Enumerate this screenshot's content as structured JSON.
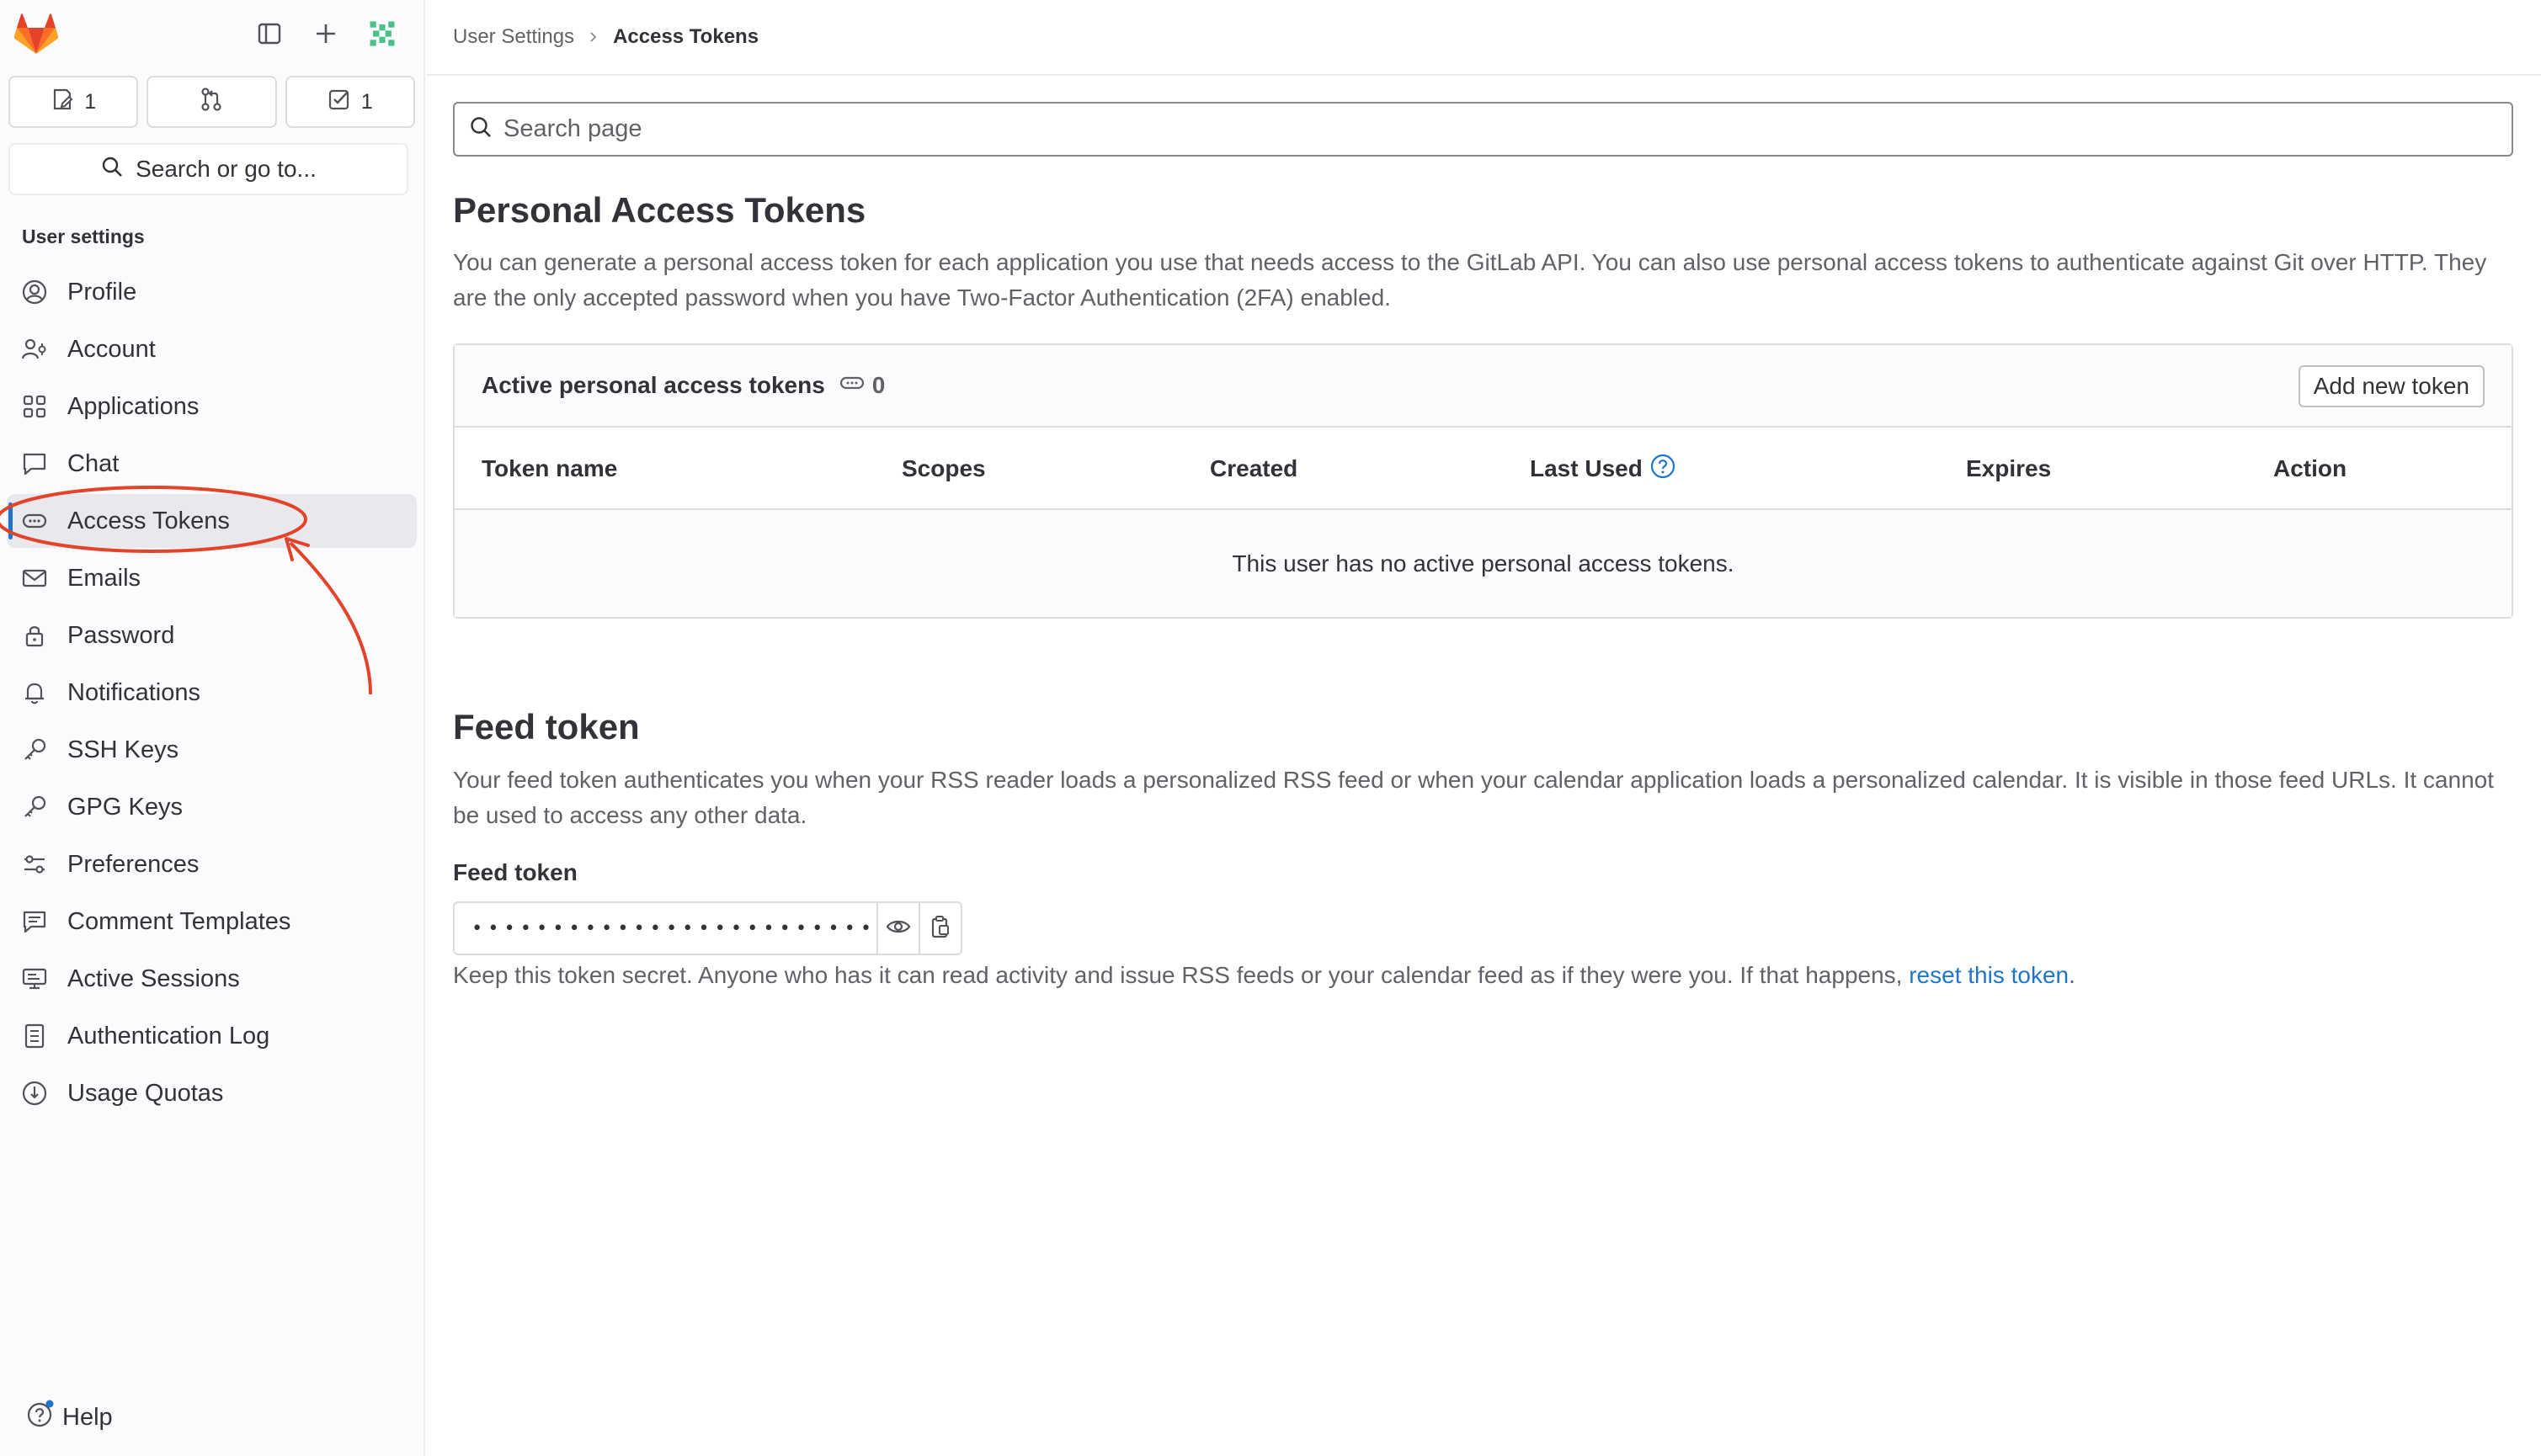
{
  "sidebar": {
    "counts": {
      "issues": "1",
      "todos": "1"
    },
    "search_label": "Search or go to...",
    "section_title": "User settings",
    "items": [
      {
        "label": "Profile",
        "icon": "profile-icon"
      },
      {
        "label": "Account",
        "icon": "account-icon"
      },
      {
        "label": "Applications",
        "icon": "applications-icon"
      },
      {
        "label": "Chat",
        "icon": "chat-icon"
      },
      {
        "label": "Access Tokens",
        "icon": "token-icon",
        "active": true
      },
      {
        "label": "Emails",
        "icon": "mail-icon"
      },
      {
        "label": "Password",
        "icon": "lock-icon"
      },
      {
        "label": "Notifications",
        "icon": "bell-icon"
      },
      {
        "label": "SSH Keys",
        "icon": "key-icon"
      },
      {
        "label": "GPG Keys",
        "icon": "key-icon"
      },
      {
        "label": "Preferences",
        "icon": "preferences-icon"
      },
      {
        "label": "Comment Templates",
        "icon": "comment-icon"
      },
      {
        "label": "Active Sessions",
        "icon": "monitor-icon"
      },
      {
        "label": "Authentication Log",
        "icon": "log-icon"
      },
      {
        "label": "Usage Quotas",
        "icon": "quota-icon"
      }
    ],
    "help_label": "Help"
  },
  "breadcrumb": {
    "parent": "User Settings",
    "current": "Access Tokens"
  },
  "search": {
    "placeholder": "Search page"
  },
  "pat": {
    "title": "Personal Access Tokens",
    "description": "You can generate a personal access token for each application you use that needs access to the GitLab API. You can also use personal access tokens to authenticate against Git over HTTP. They are the only accepted password when you have Two-Factor Authentication (2FA) enabled.",
    "card_title": "Active personal access tokens",
    "active_count": "0",
    "add_button": "Add new token",
    "columns": [
      "Token name",
      "Scopes",
      "Created",
      "Last Used",
      "Expires",
      "Action"
    ],
    "empty_message": "This user has no active personal access tokens."
  },
  "feed": {
    "title": "Feed token",
    "description": "Your feed token authenticates you when your RSS reader loads a personalized RSS feed or when your calendar application loads a personalized calendar. It is visible in those feed URLs. It cannot be used to access any other data.",
    "label": "Feed token",
    "masked_value": "•••••••••••••••••••••••••",
    "help_prefix": "Keep this token secret. Anyone who has it can read activity and issue RSS feeds or your calendar feed as if they were you. If that happens, ",
    "help_link": "reset this token",
    "help_suffix": "."
  },
  "colors": {
    "accent": "#1f75cb",
    "annotation": "#e24329"
  }
}
